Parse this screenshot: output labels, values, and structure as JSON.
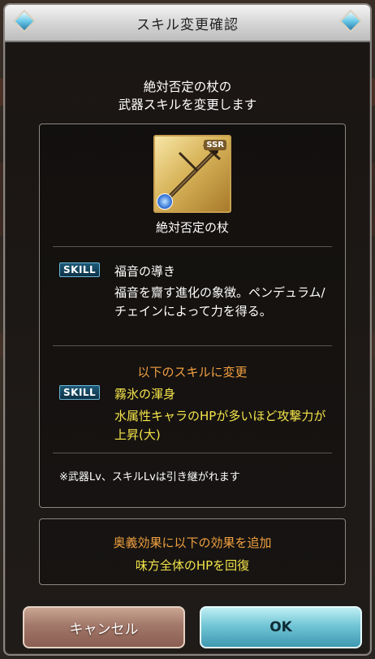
{
  "dialog": {
    "title": "スキル変更確認",
    "header_line1": "絶対否定の杖の",
    "header_line2": "武器スキルを変更します"
  },
  "weapon": {
    "name": "絶対否定の杖",
    "rarity": "SSR"
  },
  "current_skill": {
    "badge": "SKILL",
    "name": "福音の導き",
    "description": "福音を齎す進化の象徴。ペンデュラム/チェインによって力を得る。"
  },
  "change": {
    "label": "以下のスキルに変更",
    "badge": "SKILL",
    "name": "霧氷の渾身",
    "description": "水属性キャラのHPが多いほど攻撃力が上昇(大)"
  },
  "note": "※武器Lv、スキルLvは引き継がれます",
  "ougi": {
    "title": "奥義効果に以下の効果を追加",
    "effect": "味方全体のHPを回復"
  },
  "buttons": {
    "cancel": "キャンセル",
    "ok": "OK"
  },
  "colors": {
    "accent_orange": "#f0a040",
    "accent_yellow": "#f4e44a",
    "ok_button": "#72c6d6",
    "cancel_button": "#a2786a"
  }
}
